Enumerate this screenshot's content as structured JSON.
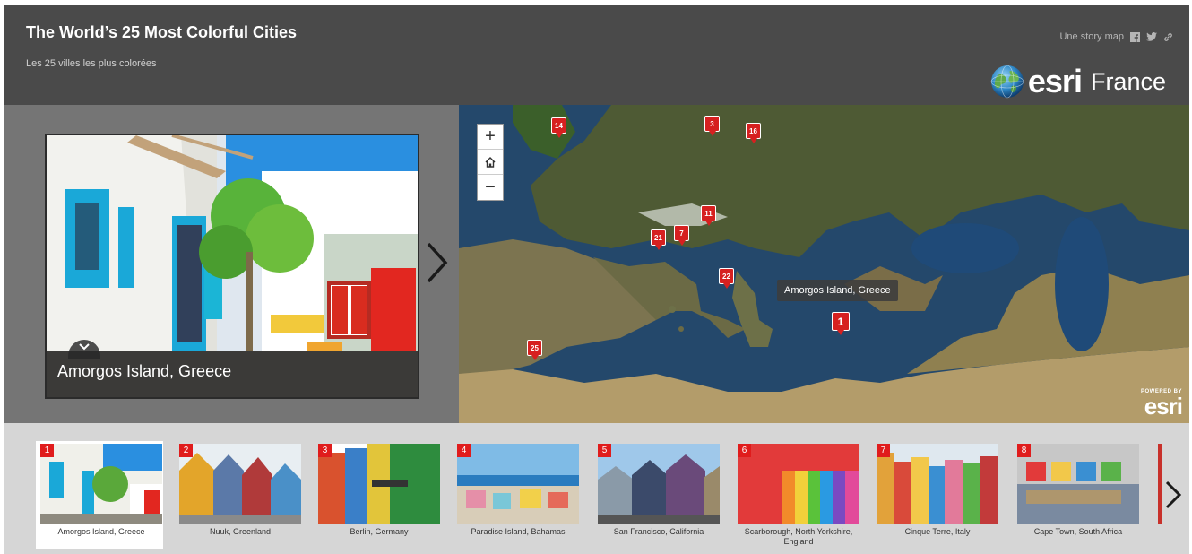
{
  "header": {
    "title": "The World’s 25 Most Colorful Cities",
    "subtitle": "Les 25 villes les plus colorées",
    "story_label": "Une story map",
    "logo_text": "esri",
    "logo_region": "France"
  },
  "featured": {
    "caption": "Amorgos Island, Greece"
  },
  "map": {
    "tooltip": "Amorgos Island, Greece",
    "powered_by": "POWERED BY",
    "powered_brand": "esri",
    "pins": [
      "14",
      "3",
      "16",
      "11",
      "21",
      "7",
      "22",
      "1",
      "25"
    ]
  },
  "carousel": {
    "items": [
      {
        "num": "1",
        "label": "Amorgos Island, Greece"
      },
      {
        "num": "2",
        "label": "Nuuk, Greenland"
      },
      {
        "num": "3",
        "label": "Berlin, Germany"
      },
      {
        "num": "4",
        "label": "Paradise Island, Bahamas"
      },
      {
        "num": "5",
        "label": "San Francisco, California"
      },
      {
        "num": "6",
        "label": "Scarborough, North Yorkshire, England"
      },
      {
        "num": "7",
        "label": "Cinque Terre, Italy"
      },
      {
        "num": "8",
        "label": "Cape Town, South Africa"
      }
    ]
  },
  "colors": {
    "header_bg": "#4a4a4a",
    "pin_red": "#d62020",
    "carousel_bg": "#d6d6d6"
  }
}
